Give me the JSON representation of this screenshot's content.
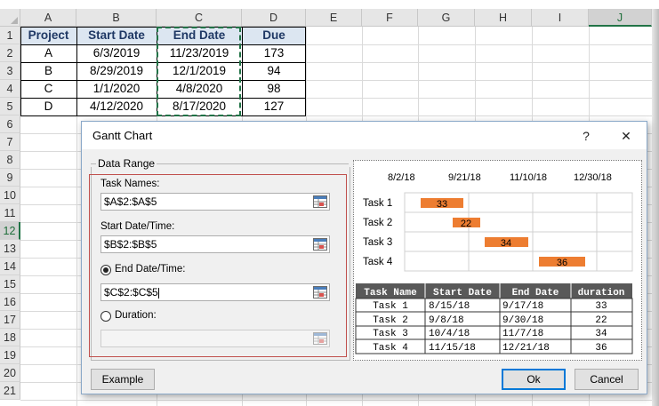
{
  "spreadsheet": {
    "columns": [
      "A",
      "B",
      "C",
      "D",
      "E",
      "F",
      "G",
      "H",
      "I",
      "J"
    ],
    "selected_column": "J",
    "rows": [
      "1",
      "2",
      "3",
      "4",
      "5",
      "6",
      "7",
      "8",
      "9",
      "10",
      "11",
      "12",
      "13",
      "14",
      "15",
      "16",
      "17",
      "18",
      "19",
      "20",
      "21"
    ],
    "selected_row": "12",
    "table": {
      "headers": [
        "Project",
        "Start Date",
        "End Date",
        "Due"
      ],
      "data": [
        [
          "A",
          "6/3/2019",
          "11/23/2019",
          "173"
        ],
        [
          "B",
          "8/29/2019",
          "12/1/2019",
          "94"
        ],
        [
          "C",
          "1/1/2020",
          "4/8/2020",
          "98"
        ],
        [
          "D",
          "4/12/2020",
          "8/17/2020",
          "127"
        ]
      ]
    }
  },
  "dialog": {
    "title": "Gantt Chart",
    "help_glyph": "?",
    "close_glyph": "✕",
    "group_label": "Data Range",
    "task_names_label": "Task Names:",
    "task_names_value": "$A$2:$A$5",
    "start_label": "Start Date/Time:",
    "start_value": "$B$2:$B$5",
    "end_label": "End Date/Time:",
    "end_value": "$C$2:$C$5",
    "end_selected": true,
    "duration_label": "Duration:",
    "duration_value": "",
    "example_button": "Example",
    "ok_button": "Ok",
    "cancel_button": "Cancel",
    "icons": {
      "range_select": "range-select-icon",
      "help": "help-icon",
      "close": "close-icon"
    }
  },
  "preview": {
    "date_ticks": [
      "8/2/18",
      "9/21/18",
      "11/10/18",
      "12/30/18"
    ],
    "tasks": [
      "Task 1",
      "Task 2",
      "Task 3",
      "Task 4"
    ],
    "bar_durations": [
      "33",
      "22",
      "34",
      "36"
    ],
    "bar_color": "#ed7d31",
    "table_headers": [
      "Task Name",
      "Start Date",
      "End Date",
      "duration"
    ],
    "table_rows": [
      [
        "Task 1",
        "8/15/18",
        "9/17/18",
        "33"
      ],
      [
        "Task 2",
        "9/8/18",
        "9/30/18",
        "22"
      ],
      [
        "Task 3",
        "10/4/18",
        "11/7/18",
        "34"
      ],
      [
        "Task 4",
        "11/15/18",
        "12/21/18",
        "36"
      ]
    ]
  }
}
